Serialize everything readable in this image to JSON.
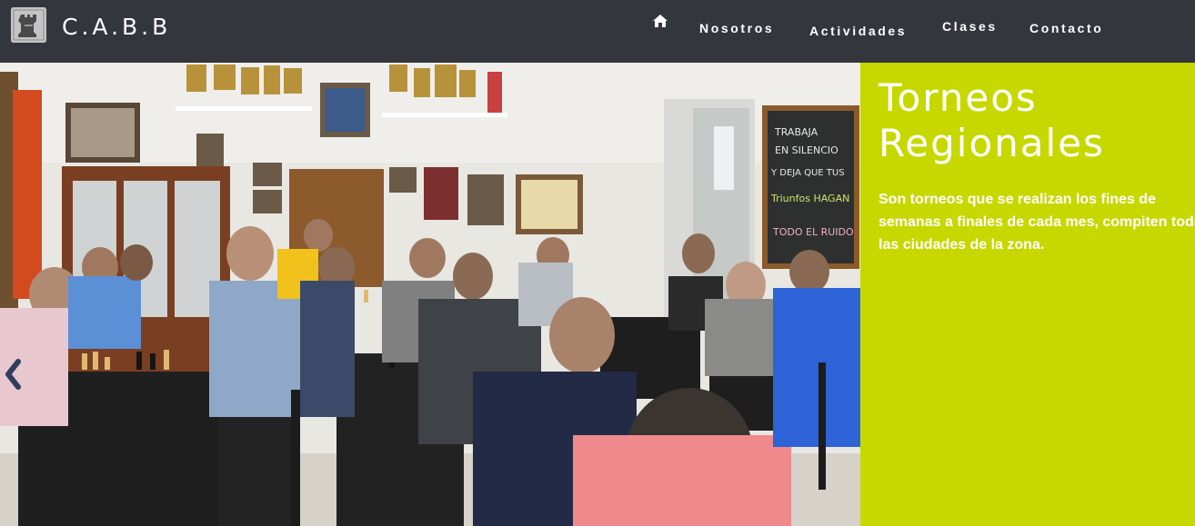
{
  "navbar": {
    "brand": "C.A.B.B",
    "logo_icon": "chess-rook-icon",
    "home_icon": "home-icon",
    "items": [
      {
        "label": "Nosotros"
      },
      {
        "label": "Actividades"
      },
      {
        "label": "Clases"
      },
      {
        "label": "Contacto"
      }
    ]
  },
  "slide": {
    "title": "Torneos\nRegionales",
    "title_line1": "Torneos",
    "title_line2": "Regionales",
    "description_line1": "Son torneos que se realizan los fines de",
    "description_line2": "semanas a finales de cada mes, compiten todas",
    "description_line3": "las ciudades de la zona.",
    "photo_chalkboard_text": [
      "TRABAJA",
      "EN SILENCIO",
      "Y DEJA QUE TUS",
      "Triunfos HAGAN",
      "TODO EL RUIDO"
    ],
    "prev_control_icon": "chevron-left-icon"
  },
  "colors": {
    "navbar_bg": "#33363d",
    "caption_bg": "#c6d800",
    "text": "#ffffff"
  }
}
